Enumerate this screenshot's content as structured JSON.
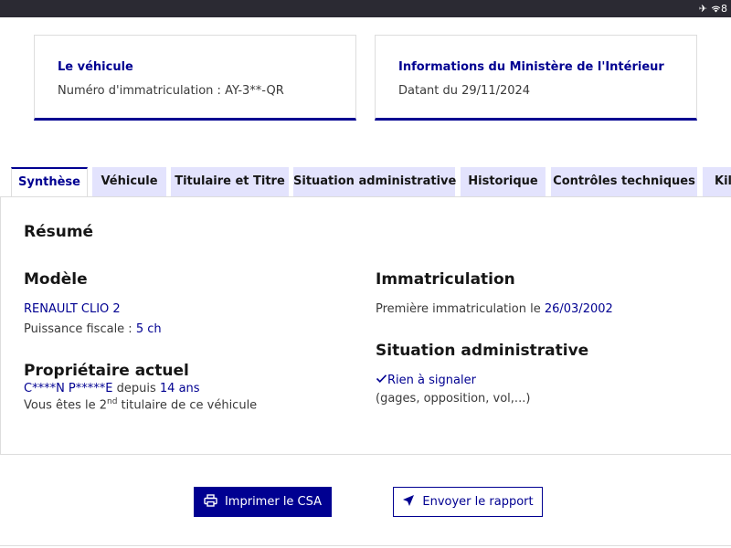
{
  "status_bar": {
    "icons": [
      "airplane-icon",
      "wifi-icon"
    ],
    "partial_text": "8"
  },
  "cards": [
    {
      "title": "Le véhicule",
      "text": "Numéro d'immatriculation : AY-3**-QR"
    },
    {
      "title": "Informations du Ministère de l'Intérieur",
      "text": "Datant du 29/11/2024"
    }
  ],
  "tabs": [
    {
      "label": "Synthèse",
      "active": true
    },
    {
      "label": "Véhicule"
    },
    {
      "label": "Titulaire et Titre"
    },
    {
      "label": "Situation administrative"
    },
    {
      "label": "Historique"
    },
    {
      "label": "Contrôles techniques"
    },
    {
      "label": "Kilo"
    }
  ],
  "summary": {
    "title": "Résumé",
    "model": {
      "heading": "Modèle",
      "name": "RENAULT CLIO 2",
      "power_label": "Puissance fiscale : ",
      "power_value": "5 ch"
    },
    "owner": {
      "heading": "Propriétaire actuel",
      "name": "C****N P*****E",
      "since_label": " depuis ",
      "since_value": "14 ans",
      "rank_prefix": "Vous êtes le 2",
      "rank_sup": "nd",
      "rank_suffix": " titulaire de ce véhicule"
    },
    "registration": {
      "heading": "Immatriculation",
      "label": "Première immatriculation le ",
      "date": "26/03/2002"
    },
    "admin": {
      "heading": "Situation administrative",
      "status": "Rien à signaler",
      "details": "(gages, opposition, vol,...)"
    }
  },
  "actions": {
    "print_label": "Imprimer le CSA",
    "send_label": "Envoyer le rapport"
  },
  "colors": {
    "primary": "#000091",
    "tab_bg": "#e3e3fd",
    "text": "#3a3a3a",
    "heading": "#161616"
  }
}
